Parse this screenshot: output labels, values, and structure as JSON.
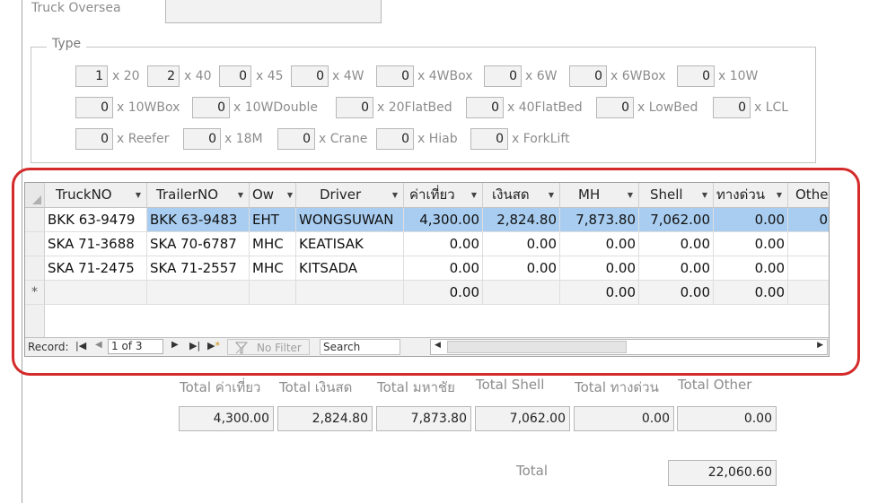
{
  "top": {
    "truck_oversea_label": "Truck Oversea",
    "truck_oversea_value": ""
  },
  "type_group": {
    "legend": "Type",
    "rows": [
      [
        {
          "v": "1",
          "l": "x 20"
        },
        {
          "v": "2",
          "l": "x 40"
        },
        {
          "v": "0",
          "l": "x 45"
        },
        {
          "v": "0",
          "l": "x 4W"
        },
        {
          "v": "0",
          "l": "x 4WBox"
        },
        {
          "v": "0",
          "l": "x 6W"
        },
        {
          "v": "0",
          "l": "x 6WBox"
        },
        {
          "v": "0",
          "l": "x 10W"
        }
      ],
      [
        {
          "v": "0",
          "l": "x 10WBox"
        },
        {
          "v": "0",
          "l": "x 10WDouble"
        },
        {
          "v": "0",
          "l": "x 20FlatBed"
        },
        {
          "v": "0",
          "l": "x 40FlatBed"
        },
        {
          "v": "0",
          "l": "x LowBed"
        },
        {
          "v": "0",
          "l": "x LCL"
        }
      ],
      [
        {
          "v": "0",
          "l": "x Reefer"
        },
        {
          "v": "0",
          "l": "x 18M"
        },
        {
          "v": "0",
          "l": "x Crane"
        },
        {
          "v": "0",
          "l": "x Hiab"
        },
        {
          "v": "0",
          "l": "x ForkLift"
        }
      ]
    ]
  },
  "grid": {
    "columns": [
      "TruckNO",
      "TrailerNO",
      "Ow",
      "Driver",
      "ค่าเที่ยว",
      "เงินสด",
      "MH",
      "Shell",
      "ทางด่วน",
      "Othe"
    ],
    "rows": [
      [
        "BKK 63-9479",
        "BKK 63-9483",
        "EHT",
        "WONGSUWAN",
        "4,300.00",
        "2,824.80",
        "7,873.80",
        "7,062.00",
        "0.00",
        "0"
      ],
      [
        "SKA 71-3688",
        "SKA 70-6787",
        "MHC",
        "KEATISAK",
        "0.00",
        "0.00",
        "0.00",
        "0.00",
        "0.00",
        ""
      ],
      [
        "SKA 71-2475",
        "SKA 71-2557",
        "MHC",
        "KITSADA",
        "0.00",
        "0.00",
        "0.00",
        "0.00",
        "0.00",
        ""
      ]
    ],
    "new_row": [
      "",
      "",
      "",
      "",
      "0.00",
      "",
      "0.00",
      "0.00",
      "0.00",
      ""
    ],
    "new_row_marker": "*",
    "nav": {
      "record_label": "Record:",
      "position": "1 of 3",
      "no_filter": "No Filter",
      "search": "Search"
    }
  },
  "totals": {
    "labels": [
      "Total ค่าเที่ยว",
      "Total เงินสด",
      "Total มหาชัย",
      "Total Shell",
      "Total ทางด่วน",
      "Total Other"
    ],
    "values": [
      "4,300.00",
      "2,824.80",
      "7,873.80",
      "7,062.00",
      "0.00",
      "0.00"
    ],
    "grand_label": "Total",
    "grand_value": "22,060.60"
  },
  "colors": {
    "highlight": "#a9cdf0",
    "frame": "#d42a2a"
  }
}
